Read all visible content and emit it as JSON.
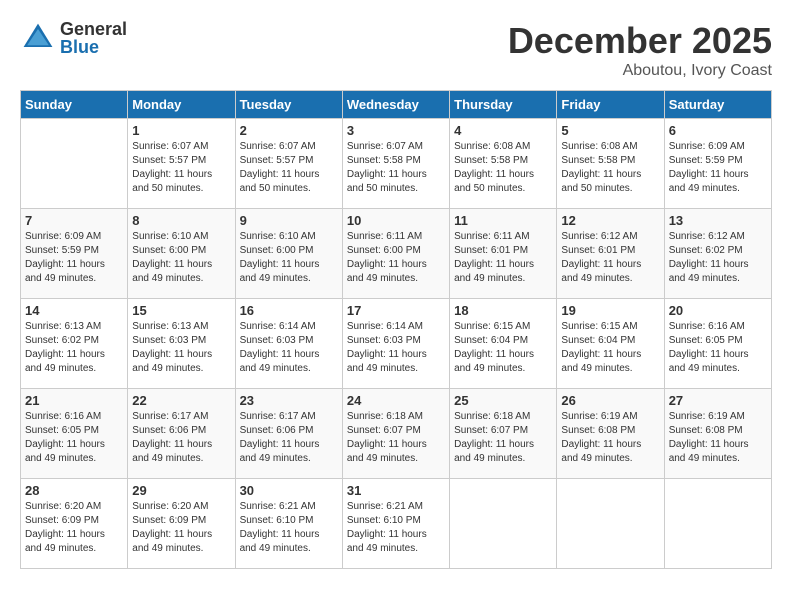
{
  "header": {
    "logo_general": "General",
    "logo_blue": "Blue",
    "month_title": "December 2025",
    "location": "Aboutou, Ivory Coast"
  },
  "calendar": {
    "days_of_week": [
      "Sunday",
      "Monday",
      "Tuesday",
      "Wednesday",
      "Thursday",
      "Friday",
      "Saturday"
    ],
    "weeks": [
      [
        {
          "day": null,
          "sunrise": null,
          "sunset": null,
          "daylight": null
        },
        {
          "day": "1",
          "sunrise": "6:07 AM",
          "sunset": "5:57 PM",
          "daylight": "11 hours and 50 minutes."
        },
        {
          "day": "2",
          "sunrise": "6:07 AM",
          "sunset": "5:57 PM",
          "daylight": "11 hours and 50 minutes."
        },
        {
          "day": "3",
          "sunrise": "6:07 AM",
          "sunset": "5:58 PM",
          "daylight": "11 hours and 50 minutes."
        },
        {
          "day": "4",
          "sunrise": "6:08 AM",
          "sunset": "5:58 PM",
          "daylight": "11 hours and 50 minutes."
        },
        {
          "day": "5",
          "sunrise": "6:08 AM",
          "sunset": "5:58 PM",
          "daylight": "11 hours and 50 minutes."
        },
        {
          "day": "6",
          "sunrise": "6:09 AM",
          "sunset": "5:59 PM",
          "daylight": "11 hours and 49 minutes."
        }
      ],
      [
        {
          "day": "7",
          "sunrise": "6:09 AM",
          "sunset": "5:59 PM",
          "daylight": "11 hours and 49 minutes."
        },
        {
          "day": "8",
          "sunrise": "6:10 AM",
          "sunset": "6:00 PM",
          "daylight": "11 hours and 49 minutes."
        },
        {
          "day": "9",
          "sunrise": "6:10 AM",
          "sunset": "6:00 PM",
          "daylight": "11 hours and 49 minutes."
        },
        {
          "day": "10",
          "sunrise": "6:11 AM",
          "sunset": "6:00 PM",
          "daylight": "11 hours and 49 minutes."
        },
        {
          "day": "11",
          "sunrise": "6:11 AM",
          "sunset": "6:01 PM",
          "daylight": "11 hours and 49 minutes."
        },
        {
          "day": "12",
          "sunrise": "6:12 AM",
          "sunset": "6:01 PM",
          "daylight": "11 hours and 49 minutes."
        },
        {
          "day": "13",
          "sunrise": "6:12 AM",
          "sunset": "6:02 PM",
          "daylight": "11 hours and 49 minutes."
        }
      ],
      [
        {
          "day": "14",
          "sunrise": "6:13 AM",
          "sunset": "6:02 PM",
          "daylight": "11 hours and 49 minutes."
        },
        {
          "day": "15",
          "sunrise": "6:13 AM",
          "sunset": "6:03 PM",
          "daylight": "11 hours and 49 minutes."
        },
        {
          "day": "16",
          "sunrise": "6:14 AM",
          "sunset": "6:03 PM",
          "daylight": "11 hours and 49 minutes."
        },
        {
          "day": "17",
          "sunrise": "6:14 AM",
          "sunset": "6:03 PM",
          "daylight": "11 hours and 49 minutes."
        },
        {
          "day": "18",
          "sunrise": "6:15 AM",
          "sunset": "6:04 PM",
          "daylight": "11 hours and 49 minutes."
        },
        {
          "day": "19",
          "sunrise": "6:15 AM",
          "sunset": "6:04 PM",
          "daylight": "11 hours and 49 minutes."
        },
        {
          "day": "20",
          "sunrise": "6:16 AM",
          "sunset": "6:05 PM",
          "daylight": "11 hours and 49 minutes."
        }
      ],
      [
        {
          "day": "21",
          "sunrise": "6:16 AM",
          "sunset": "6:05 PM",
          "daylight": "11 hours and 49 minutes."
        },
        {
          "day": "22",
          "sunrise": "6:17 AM",
          "sunset": "6:06 PM",
          "daylight": "11 hours and 49 minutes."
        },
        {
          "day": "23",
          "sunrise": "6:17 AM",
          "sunset": "6:06 PM",
          "daylight": "11 hours and 49 minutes."
        },
        {
          "day": "24",
          "sunrise": "6:18 AM",
          "sunset": "6:07 PM",
          "daylight": "11 hours and 49 minutes."
        },
        {
          "day": "25",
          "sunrise": "6:18 AM",
          "sunset": "6:07 PM",
          "daylight": "11 hours and 49 minutes."
        },
        {
          "day": "26",
          "sunrise": "6:19 AM",
          "sunset": "6:08 PM",
          "daylight": "11 hours and 49 minutes."
        },
        {
          "day": "27",
          "sunrise": "6:19 AM",
          "sunset": "6:08 PM",
          "daylight": "11 hours and 49 minutes."
        }
      ],
      [
        {
          "day": "28",
          "sunrise": "6:20 AM",
          "sunset": "6:09 PM",
          "daylight": "11 hours and 49 minutes."
        },
        {
          "day": "29",
          "sunrise": "6:20 AM",
          "sunset": "6:09 PM",
          "daylight": "11 hours and 49 minutes."
        },
        {
          "day": "30",
          "sunrise": "6:21 AM",
          "sunset": "6:10 PM",
          "daylight": "11 hours and 49 minutes."
        },
        {
          "day": "31",
          "sunrise": "6:21 AM",
          "sunset": "6:10 PM",
          "daylight": "11 hours and 49 minutes."
        },
        {
          "day": null,
          "sunrise": null,
          "sunset": null,
          "daylight": null
        },
        {
          "day": null,
          "sunrise": null,
          "sunset": null,
          "daylight": null
        },
        {
          "day": null,
          "sunrise": null,
          "sunset": null,
          "daylight": null
        }
      ]
    ]
  },
  "labels": {
    "sunrise_prefix": "Sunrise: ",
    "sunset_prefix": "Sunset: ",
    "daylight_prefix": "Daylight: "
  }
}
